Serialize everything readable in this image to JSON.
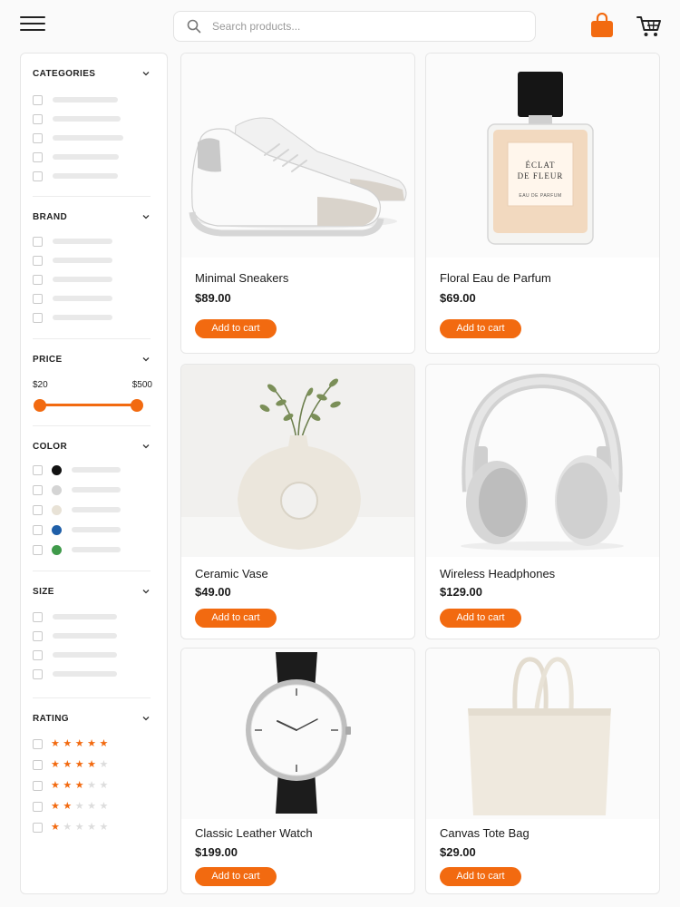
{
  "header": {
    "search_placeholder": "Search products...",
    "accent_color": "#f26a10"
  },
  "filters": {
    "categories": {
      "title": "CATEGORIES"
    },
    "brand": {
      "title": "BRAND"
    },
    "price": {
      "title": "PRICE",
      "min_label": "$20",
      "max_label": "$500"
    },
    "color": {
      "title": "COLOR",
      "swatches": [
        "#111111",
        "#d4d4d4",
        "#e8e2d6",
        "#1f5fa8",
        "#3f9a4a"
      ]
    },
    "size": {
      "title": "SIZE"
    },
    "rating": {
      "title": "RATING",
      "levels": [
        5,
        4,
        3,
        2,
        1
      ]
    }
  },
  "products": [
    {
      "name": "Minimal Sneakers",
      "price": "$89.00",
      "button": "Add to cart",
      "icon": "sneakers-image"
    },
    {
      "name": "Floral Eau de Parfum",
      "price": "$69.00",
      "button": "Add to cart",
      "icon": "perfume-image",
      "bottle_label_line1": "ÉCLAT",
      "bottle_label_line2": "DE FLEUR",
      "bottle_label_line3": "EAU DE PARFUM"
    },
    {
      "name": "Ceramic Vase",
      "price": "$49.00",
      "button": "Add to cart",
      "icon": "vase-image"
    },
    {
      "name": "Wireless Headphones",
      "price": "$129.00",
      "button": "Add to cart",
      "icon": "headphones-image"
    },
    {
      "name": "Classic Leather Watch",
      "price": "$199.00",
      "button": "Add to cart",
      "icon": "watch-image"
    },
    {
      "name": "Canvas Tote Bag",
      "price": "$29.00",
      "button": "Add to cart",
      "icon": "tote-bag-image"
    }
  ]
}
